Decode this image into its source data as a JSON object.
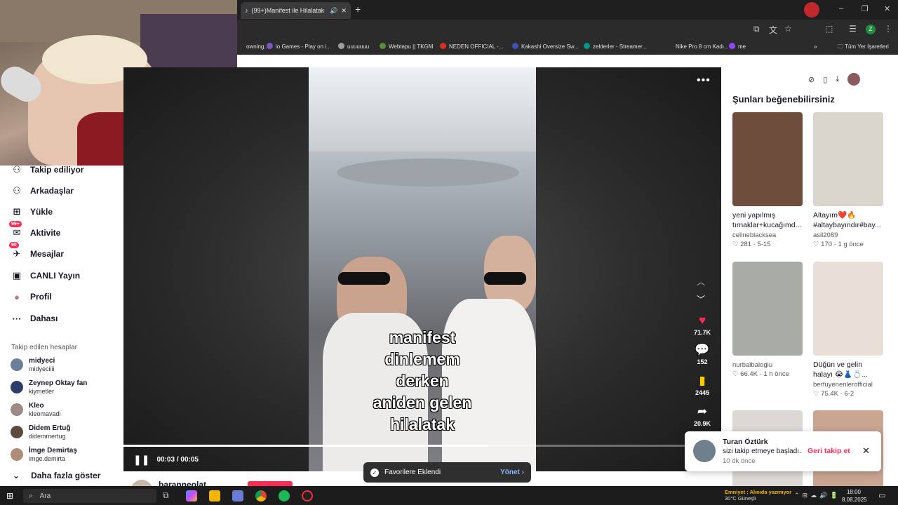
{
  "browser": {
    "tab_title": "(99+)Manifest ile Hilalatak",
    "new_tab": "+",
    "bookmarks": [
      {
        "label": "owning...",
        "color": "#2b2b2b"
      },
      {
        "label": "io Games - Play on i...",
        "color": "#7e57c2"
      },
      {
        "label": "uuuuuuu",
        "color": "#9e9e9e"
      },
      {
        "label": "Webtapu || TKGM",
        "color": "#5d8a3a"
      },
      {
        "label": "NEDEN OFFICIAL -...",
        "color": "#d93025"
      },
      {
        "label": "Kakashi Oversize Sw...",
        "color": "#3f51b5"
      },
      {
        "label": "zelderler - Streamer...",
        "color": "#009688"
      },
      {
        "label": "Nike Pro 8 cm Kadı...",
        "color": "#2b2b2b"
      },
      {
        "label": "me",
        "color": "#9146ff"
      }
    ],
    "bookmarks_folder": "Tüm Yer İşaretleri",
    "profile_initial": "Z"
  },
  "sidebar": {
    "items": [
      {
        "label": "Takip ediliyor",
        "icon": "user-follow-icon",
        "glyph": "⚇"
      },
      {
        "label": "Arkadaşlar",
        "icon": "friends-icon",
        "glyph": "⚇"
      },
      {
        "label": "Yükle",
        "icon": "upload-icon",
        "glyph": "⊞"
      },
      {
        "label": "Aktivite",
        "icon": "activity-icon",
        "glyph": "✉",
        "badge": "99+"
      },
      {
        "label": "Mesajlar",
        "icon": "messages-icon",
        "glyph": "✈",
        "badge": "90"
      },
      {
        "label": "CANLI Yayın",
        "icon": "live-icon",
        "glyph": "▣"
      },
      {
        "label": "Profil",
        "icon": "profile-icon",
        "glyph": "●"
      },
      {
        "label": "Dahası",
        "icon": "more-icon",
        "glyph": "···"
      }
    ],
    "following_title": "Takip edilen hesaplar",
    "accounts": [
      {
        "name": "midyeci",
        "user": "midyeciiii",
        "color": "#6b7f96"
      },
      {
        "name": "Zeynep Oktay fan",
        "user": "kiymetler",
        "color": "#2d3e6b"
      },
      {
        "name": "Kleo",
        "user": "kleomavadi",
        "color": "#9c8a84"
      },
      {
        "name": "Didem Ertuğ",
        "user": "didemmertug",
        "color": "#5b4a3f"
      },
      {
        "name": "İmge Demirtaş",
        "user": "imge.demirta",
        "color": "#b08c76"
      }
    ],
    "show_more": "Daha fazla göster"
  },
  "video": {
    "caption_lines": [
      "manifest",
      "dinlemem",
      "derken",
      "aniden gelen",
      "hilalatak"
    ],
    "likes": "71.7K",
    "comments": "152",
    "saves": "2445",
    "shares": "20.9K",
    "time": "00:03 / 00:05",
    "progress": 0.61,
    "author": "baranneolat"
  },
  "toast": {
    "text": "Favorilere Eklendi",
    "manage": "Yönet"
  },
  "recommendations": {
    "title": "Şunları beğenebilirsiniz",
    "cards": [
      {
        "title": "yeni yapılmış",
        "title2": "tırnaklar+kucağımd...",
        "user": "celineblacksea",
        "likes": "281",
        "time": "5-15",
        "bg": "#6e4d3c"
      },
      {
        "title": "Altayım❤️🔥",
        "title2": "#altaybayındır#bay...",
        "user": "asil2089",
        "likes": "170",
        "time": "1 g önce",
        "bg": "#d9d4cc"
      },
      {
        "title": "",
        "title2": "",
        "user": "nurbalbaloglu",
        "likes": "66.4K",
        "time": "1 h önce",
        "bg": "#a9aba7"
      },
      {
        "title": "Düğün ve gelin",
        "title2": "halayı 😭👗💍...",
        "user": "berfuyenenlerofficial",
        "likes": "75.4K",
        "time": "6-2",
        "bg": "#e9dfd8"
      },
      {
        "title": "",
        "title2": "",
        "user": "",
        "likes": "",
        "time": "",
        "bg": "#dcd8d4"
      },
      {
        "title": "",
        "title2": "",
        "user": "",
        "likes": "",
        "time": "",
        "bg": "#c9a592"
      }
    ]
  },
  "notification": {
    "name": "Turan Öztürk",
    "message": "sizi takip etmeye başladı.",
    "time": "10 dk önce",
    "button": "Geri takip et"
  },
  "taskbar": {
    "search": "Ara",
    "weather_alert": "Emniyet : Alınıda yazmıyor",
    "weather": "30°C  Güneşli",
    "time": "18:00",
    "date": "8.08.2025"
  },
  "colors": {
    "accent": "#fe2c55",
    "like": "#fe2c55",
    "save": "#facd00"
  }
}
